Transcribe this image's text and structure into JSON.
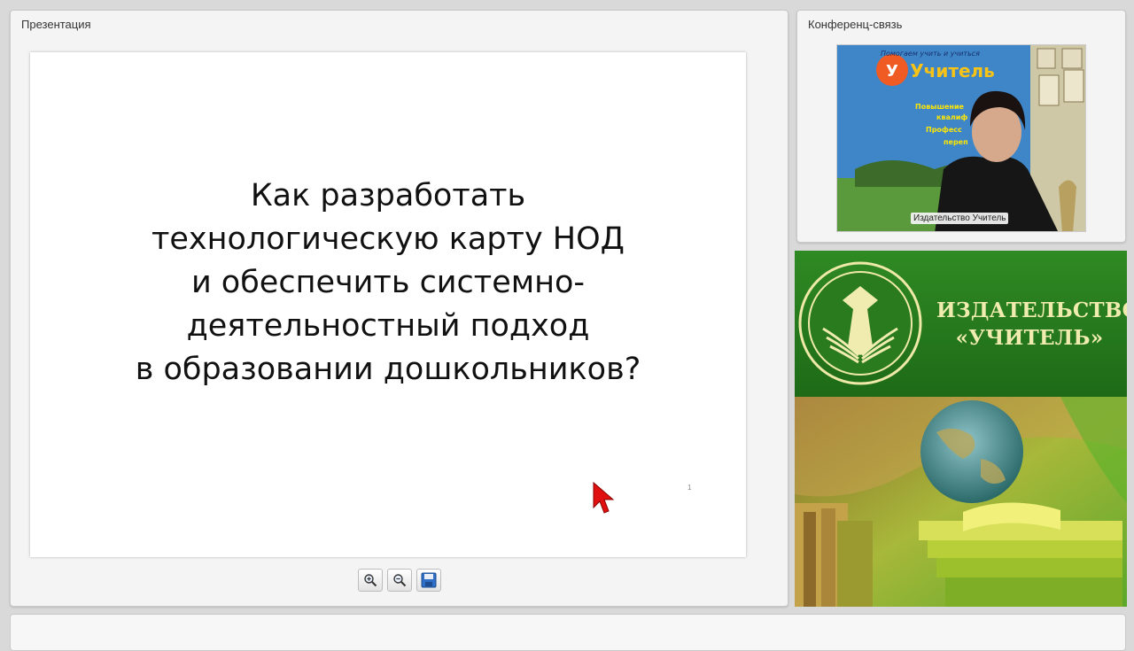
{
  "presentation_panel": {
    "title": "Презентация",
    "slide": {
      "lines": [
        "Как разработать",
        "технологическую карту НОД",
        "и обеспечить системно-",
        "деятельностный подход",
        "в образовании дошкольников?"
      ],
      "page_number": "1"
    },
    "toolbar": {
      "zoom_in": "zoom-in-icon",
      "zoom_out": "zoom-out-icon",
      "save": "save-icon"
    }
  },
  "conference_panel": {
    "title": "Конференц-связь",
    "participant_name": "Издательство Учитель",
    "poster_lines": [
      "Помогаем учить и учиться",
      "Учитель",
      "Повышение",
      "квалиф",
      "Професс",
      "переп"
    ]
  },
  "banner": {
    "line1": "ИЗДАТЕЛЬСТВО",
    "line2": "«УЧИТЕЛЬ»"
  },
  "colors": {
    "banner_green": "#2e7d1c",
    "banner_text": "#f0ecb0",
    "cursor_red": "#e01010"
  }
}
